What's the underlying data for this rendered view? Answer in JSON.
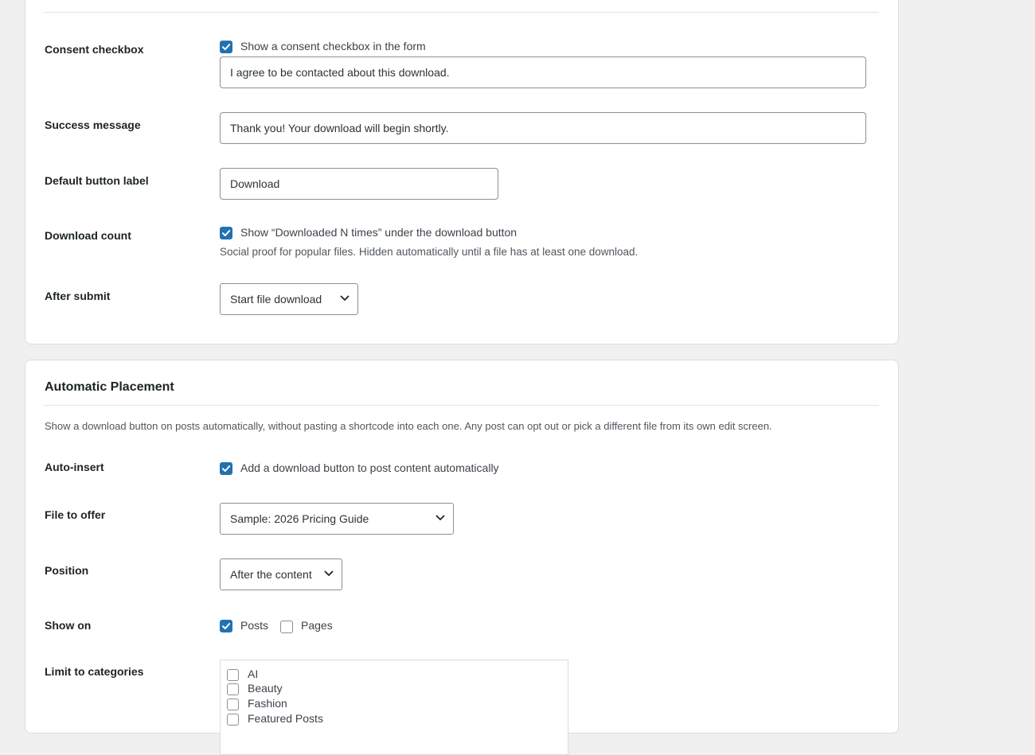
{
  "form_section": {
    "consent": {
      "label": "Consent checkbox",
      "checkbox_label": "Show a consent checkbox in the form",
      "checked": true,
      "text_value": "I agree to be contacted about this download."
    },
    "success": {
      "label": "Success message",
      "value": "Thank you! Your download will begin shortly."
    },
    "button_label": {
      "label": "Default button label",
      "value": "Download"
    },
    "download_count": {
      "label": "Download count",
      "checkbox_label": "Show “Downloaded N times” under the download button",
      "checked": true,
      "description": "Social proof for popular files. Hidden automatically until a file has at least one download."
    },
    "after_submit": {
      "label": "After submit",
      "selected": "Start file download"
    }
  },
  "placement_section": {
    "title": "Automatic Placement",
    "description": "Show a download button on posts automatically, without pasting a shortcode into each one. Any post can opt out or pick a different file from its own edit screen.",
    "auto_insert": {
      "label": "Auto-insert",
      "checkbox_label": "Add a download button to post content automatically",
      "checked": true
    },
    "file": {
      "label": "File to offer",
      "selected": "Sample: 2026 Pricing Guide"
    },
    "position": {
      "label": "Position",
      "selected": "After the content"
    },
    "show_on": {
      "label": "Show on",
      "options": [
        {
          "label": "Posts",
          "checked": true
        },
        {
          "label": "Pages",
          "checked": false
        }
      ]
    },
    "categories": {
      "label": "Limit to categories",
      "items": [
        {
          "label": "AI",
          "checked": false
        },
        {
          "label": "Beauty",
          "checked": false
        },
        {
          "label": "Fashion",
          "checked": false
        },
        {
          "label": "Featured Posts",
          "checked": false
        }
      ]
    }
  },
  "colors": {
    "accent": "#2271b1",
    "background": "#f0f0f1",
    "card": "#ffffff",
    "border": "#8c8f94"
  }
}
